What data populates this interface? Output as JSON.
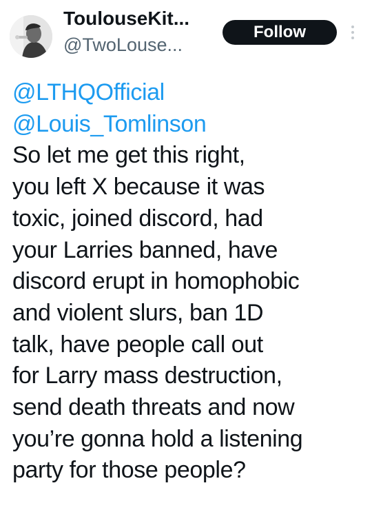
{
  "user": {
    "display_name": "ToulouseKit...",
    "handle": "@TwoLouse..."
  },
  "actions": {
    "follow_label": "Follow",
    "more_icon": "more-vertical-icon"
  },
  "tweet": {
    "mentions": [
      "@LTHQOfficial",
      "@Louis_Tomlinson"
    ],
    "lines": [
      "So let me get this right,",
      "you left X because it was",
      "toxic, joined discord, had",
      "your Larries banned, have",
      "discord erupt in homophobic",
      "and violent slurs, ban 1D",
      "talk, have people call out",
      "for Larry mass destruction,",
      "send death threats and now",
      "you’re gonna hold a listening",
      "party for those people?"
    ]
  },
  "colors": {
    "mention": "#1d9bf0",
    "text": "#0f1419",
    "muted": "#536471",
    "button_bg": "#0f1419"
  }
}
